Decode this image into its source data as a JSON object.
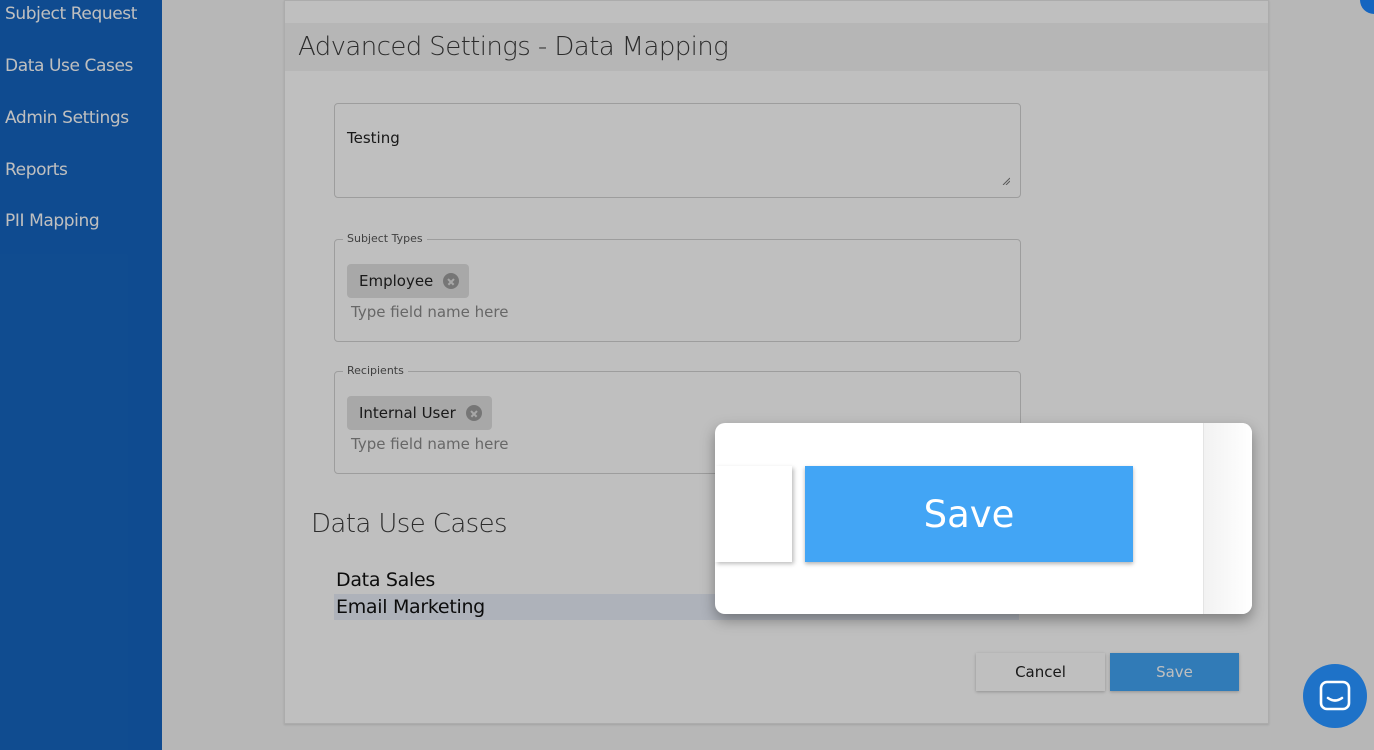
{
  "sidebar": {
    "items": [
      {
        "label": "Subject Request"
      },
      {
        "label": "Data Use Cases"
      },
      {
        "label": "Admin Settings"
      },
      {
        "label": "Reports"
      },
      {
        "label": "PII Mapping"
      }
    ]
  },
  "card": {
    "title": "Advanced Settings - Data Mapping",
    "description_value": "Testing",
    "subject_types": {
      "legend": "Subject Types",
      "chips": [
        "Employee"
      ],
      "placeholder": "Type field name here"
    },
    "recipients": {
      "legend": "Recipients",
      "chips": [
        "Internal User"
      ],
      "placeholder": "Type field name here"
    },
    "use_cases": {
      "title": "Data Use Cases",
      "items": [
        "Data Sales",
        "Email Marketing"
      ]
    }
  },
  "actions": {
    "cancel_label": "Cancel",
    "save_label": "Save"
  },
  "zoom": {
    "save_label": "Save"
  },
  "colors": {
    "sidebar": "#1565c0",
    "accent": "#42a5f5",
    "chat": "#1e72c8"
  },
  "icons": [
    "chip-remove-icon",
    "resize-handle-icon",
    "chat-icon"
  ]
}
